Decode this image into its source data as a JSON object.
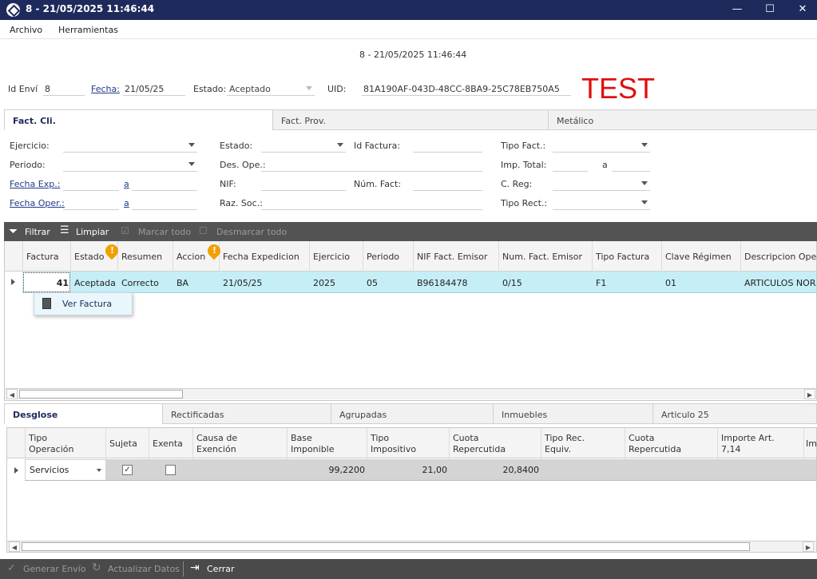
{
  "window": {
    "title": "8 - 21/05/2025 11:46:44",
    "minimize": "—",
    "maximize": "☐",
    "close": "✕"
  },
  "menu": {
    "items": [
      "Archivo",
      "Herramientas"
    ]
  },
  "header": {
    "center_title": "8 - 21/05/2025 11:46:44",
    "id_envio_label": "Id Enví",
    "id_envio_value": "8",
    "fecha_label": "Fecha:",
    "fecha_value": "21/05/25",
    "estado_label": "Estado:",
    "estado_value": "Aceptado",
    "uid_label": "UID:",
    "uid_value": "81A190AF-043D-48CC-8BA9-25C78EB750A5",
    "test_label": "TEST",
    "test_color": "#e01010"
  },
  "top_tabs": [
    "Fact. Cli.",
    "Fact. Prov.",
    "Metálico"
  ],
  "filters": {
    "ejercicio": "Ejercicio:",
    "periodo": "Periodo:",
    "fecha_exp": "Fecha Exp.:",
    "fecha_oper": "Fecha Oper.:",
    "a": "a",
    "estado": "Estado:",
    "des_ope": "Des. Ope.:",
    "nif": "NIF:",
    "raz_soc": "Raz. Soc.:",
    "id_factura": "Id Factura:",
    "num_fact": "Núm. Fact:",
    "tipo_fact": "Tipo Fact.:",
    "imp_total": "Imp. Total:",
    "c_reg": "C. Reg:",
    "tipo_rect": "Tipo Rect.:"
  },
  "toolbar": {
    "filtrar": "Filtrar",
    "limpiar": "Limpiar",
    "marcar": "Marcar todo",
    "desmarcar": "Desmarcar todo"
  },
  "main_grid": {
    "headers": [
      "Factura",
      "Estado",
      "Resumen",
      "Accion",
      "Fecha Expedicion",
      "Ejercicio",
      "Periodo",
      "NIF Fact. Emisor",
      "Num. Fact. Emisor",
      "Tipo Factura",
      "Clave Régimen",
      "Descripcion Opera"
    ],
    "row": [
      "41",
      "Aceptada",
      "Correcto",
      "BA",
      "21/05/25",
      "2025",
      "05",
      "B96184478",
      "0/15",
      "F1",
      "01",
      "ARTICULOS NORM"
    ]
  },
  "context_menu": {
    "ver_factura": "Ver Factura"
  },
  "bottom_tabs": [
    "Desglose",
    "Rectificadas",
    "Agrupadas",
    "Inmuebles",
    "Articulo 25"
  ],
  "detail_grid": {
    "headers": {
      "tipo_op": [
        "Tipo",
        "Operación"
      ],
      "sujeta": "Sujeta",
      "exenta": "Exenta",
      "causa": [
        "Causa de",
        "Exención"
      ],
      "base": [
        "Base",
        "Imponible"
      ],
      "tipo_imp": [
        "Tipo",
        "Impositivo"
      ],
      "cuota_rep": [
        "Cuota",
        "Repercutida"
      ],
      "tipo_rec": [
        "Tipo Rec.",
        "Equiv."
      ],
      "cuota_rep2": [
        "Cuota",
        "Repercutida"
      ],
      "importe": [
        "Importe Art.",
        "7,14"
      ],
      "im": "Im"
    },
    "row": {
      "tipo_op": "Servicios",
      "sujeta": true,
      "exenta": false,
      "base": "99,2200",
      "tipo_imp": "21,00",
      "cuota_rep": "20,8400"
    }
  },
  "status": {
    "generar": "Generar Envío",
    "actualizar": "Actualizar Datos",
    "cerrar": "Cerrar"
  }
}
